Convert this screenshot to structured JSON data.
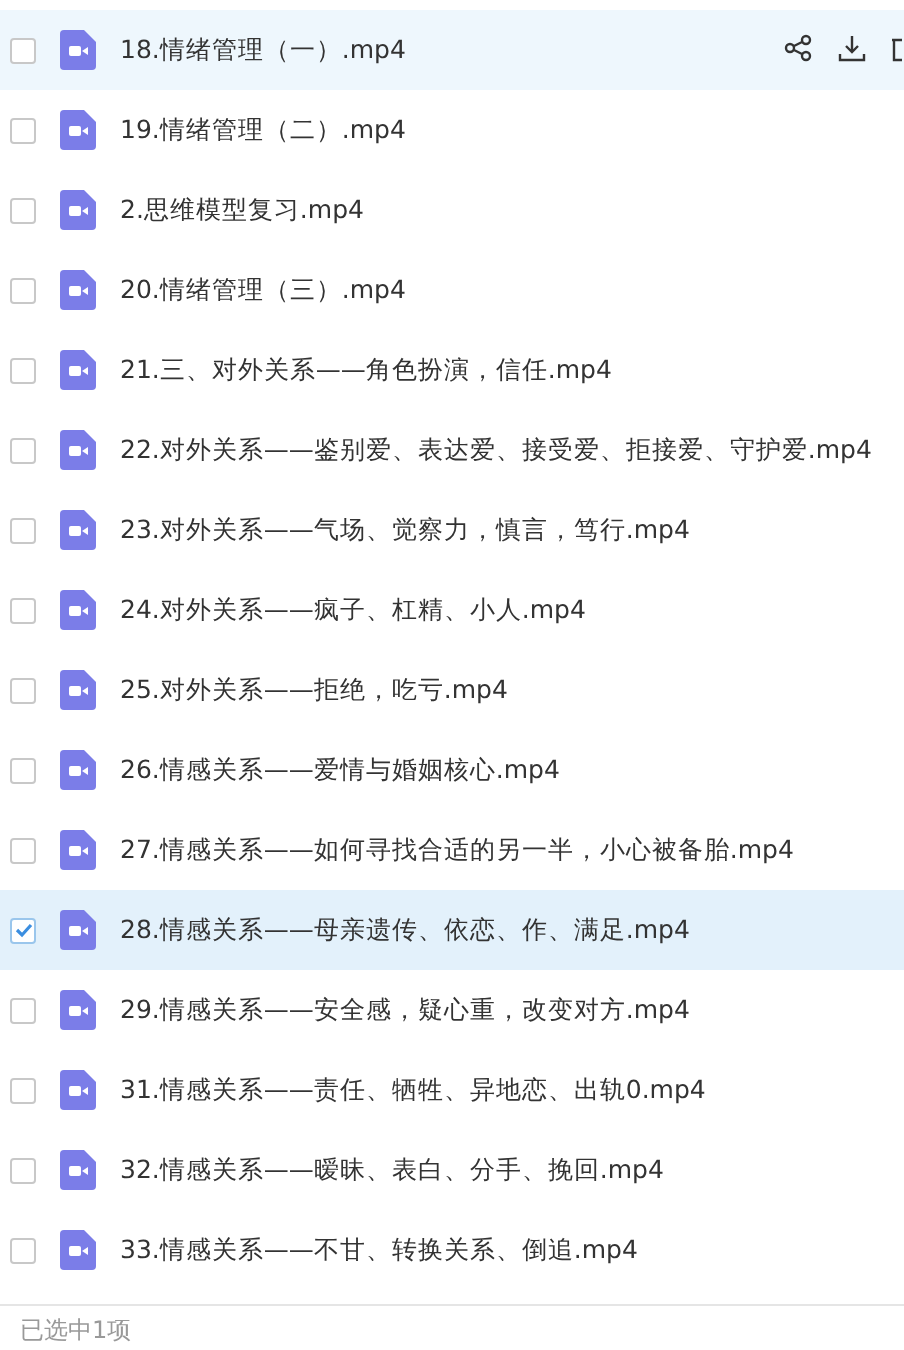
{
  "files": [
    {
      "name": "18.情绪管理（一）.mp4",
      "selected": false,
      "hovered": true
    },
    {
      "name": "19.情绪管理（二）.mp4",
      "selected": false,
      "hovered": false
    },
    {
      "name": "2.思维模型复习.mp4",
      "selected": false,
      "hovered": false
    },
    {
      "name": "20.情绪管理（三）.mp4",
      "selected": false,
      "hovered": false
    },
    {
      "name": "21.三、对外关系——角色扮演，信任.mp4",
      "selected": false,
      "hovered": false
    },
    {
      "name": "22.对外关系——鉴别爱、表达爱、接受爱、拒接爱、守护爱.mp4",
      "selected": false,
      "hovered": false
    },
    {
      "name": "23.对外关系——气场、觉察力，慎言，笃行.mp4",
      "selected": false,
      "hovered": false
    },
    {
      "name": "24.对外关系——疯子、杠精、小人.mp4",
      "selected": false,
      "hovered": false
    },
    {
      "name": "25.对外关系——拒绝，吃亏.mp4",
      "selected": false,
      "hovered": false
    },
    {
      "name": "26.情感关系——爱情与婚姻核心.mp4",
      "selected": false,
      "hovered": false
    },
    {
      "name": "27.情感关系——如何寻找合适的另一半，小心被备胎.mp4",
      "selected": false,
      "hovered": false
    },
    {
      "name": "28.情感关系——母亲遗传、依恋、作、满足.mp4",
      "selected": true,
      "hovered": false
    },
    {
      "name": "29.情感关系——安全感，疑心重，改变对方.mp4",
      "selected": false,
      "hovered": false
    },
    {
      "name": "31.情感关系——责任、牺牲、异地恋、出轨0.mp4",
      "selected": false,
      "hovered": false
    },
    {
      "name": "32.情感关系——暧昧、表白、分手、挽回.mp4",
      "selected": false,
      "hovered": false
    },
    {
      "name": "33.情感关系——不甘、转换关系、倒追.mp4",
      "selected": false,
      "hovered": false
    }
  ],
  "status_bar": "已选中1项"
}
